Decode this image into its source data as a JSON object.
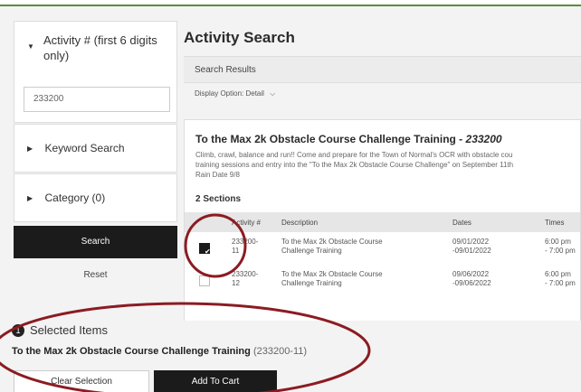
{
  "left_panel": {
    "activity_title": "Activity # (first 6 digits only)",
    "activity_value": "233200",
    "keyword_label": "Keyword Search",
    "category_label": "Category (0)",
    "search_button": "Search",
    "reset_button": "Reset"
  },
  "main": {
    "page_title": "Activity Search",
    "results_header": "Search Results",
    "display_option_label": "Display Option:",
    "display_option_value": "Detail",
    "card": {
      "title": "To the Max 2k Obstacle Course Challenge Training - ",
      "title_code": "233200",
      "desc_line1": "Climb, crawl, balance and run!! Come and prepare for the Town of Normal's OCR with obstacle cou",
      "desc_line2": "training sessions and entry into the \"To the Max 2k Obstacle Course Challenge\" on September 11th",
      "desc_line3": "Rain Date 9/8",
      "sections_label": "2 Sections"
    },
    "table": {
      "headers": {
        "activity": "Activity #",
        "description": "Description",
        "dates": "Dates",
        "times": "Times"
      },
      "rows": [
        {
          "activity_a": "233200-",
          "activity_b": "11",
          "desc_a": "To the Max 2k Obstacle Course",
          "desc_b": "Challenge Training",
          "date_a": "09/01/2022",
          "date_b": "-09/01/2022",
          "time_a": "6:00 pm",
          "time_b": "- 7:00 pm",
          "checked": true
        },
        {
          "activity_a": "233200-",
          "activity_b": "12",
          "desc_a": "To the Max 2k Obstacle Course",
          "desc_b": "Challenge Training",
          "date_a": "09/06/2022",
          "date_b": "-09/06/2022",
          "time_a": "6:00 pm",
          "time_b": "- 7:00 pm",
          "checked": false
        }
      ]
    }
  },
  "selected": {
    "number": "1",
    "heading": "Selected Items",
    "item_name": "To the Max 2k Obstacle Course Challenge Training",
    "item_code": "(233200-11)",
    "clear_button": "Clear Selection",
    "cart_button": "Add To Cart"
  },
  "colors": {
    "accent_line": "#5d8b3c",
    "annotation": "#8b1c22",
    "dark_button": "#1b1b1b"
  },
  "icons": {
    "expanded": "caret-down-icon",
    "collapsed": "caret-right-icon",
    "checkbox_checked": "check-icon"
  }
}
